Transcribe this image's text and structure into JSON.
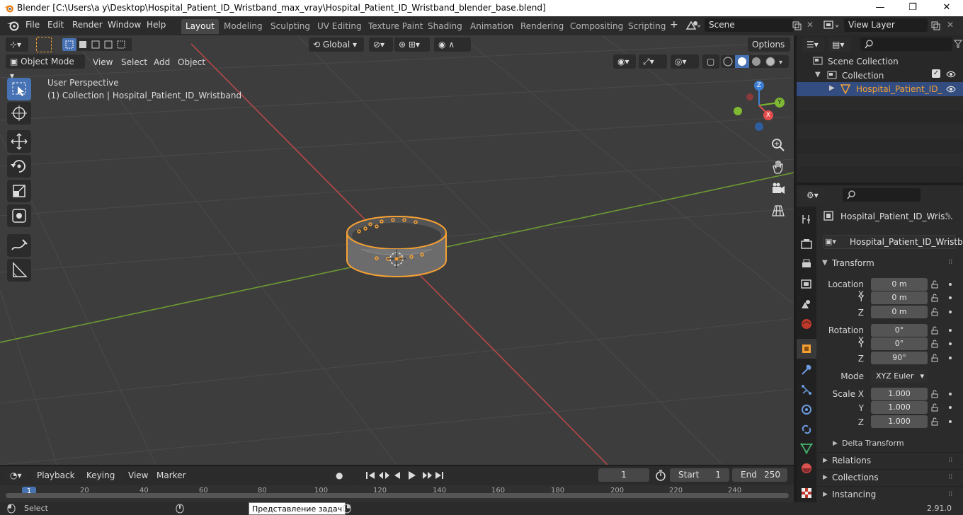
{
  "window": {
    "title": "Blender [C:\\Users\\a y\\Desktop\\Hospital_Patient_ID_Wristband_max_vray\\Hospital_Patient_ID_Wristband_blender_base.blend]",
    "minimize": "—",
    "maximize": "❐",
    "close": "✕"
  },
  "menu": {
    "items": [
      "File",
      "Edit",
      "Render",
      "Window",
      "Help"
    ],
    "workspaces": [
      "Layout",
      "Modeling",
      "Sculpting",
      "UV Editing",
      "Texture Paint",
      "Shading",
      "Animation",
      "Rendering",
      "Compositing",
      "Scripting"
    ],
    "add_workspace": "+",
    "scene": "Scene",
    "view_layer": "View Layer"
  },
  "viewport_header": {
    "transform_orientation": "Global",
    "options": "Options",
    "mode": "Object Mode",
    "menus": [
      "View",
      "Select",
      "Add",
      "Object"
    ]
  },
  "viewport": {
    "perspective": "User Perspective",
    "info": "(1) Collection | Hospital_Patient_ID_Wristband",
    "gizmo": {
      "x": "X",
      "y": "Y",
      "z": "Z"
    }
  },
  "outliner": {
    "scene_collection": "Scene Collection",
    "collection": "Collection",
    "object": "Hospital_Patient_ID_"
  },
  "properties": {
    "object_name": "Hospital_Patient_ID_Wris...",
    "data_name": "Hospital_Patient_ID_Wristba...",
    "transform_title": "Transform",
    "location_label": "Location X",
    "rotation_label": "Rotation X",
    "scale_label": "Scale X",
    "y": "Y",
    "z": "Z",
    "location": [
      "0 m",
      "0 m",
      "0 m"
    ],
    "rotation": [
      "0°",
      "0°",
      "90°"
    ],
    "mode_label": "Mode",
    "mode_value": "XYZ Euler",
    "scale": [
      "1.000",
      "1.000",
      "1.000"
    ],
    "delta": "Delta Transform",
    "sections": [
      "Relations",
      "Collections",
      "Instancing"
    ]
  },
  "timeline": {
    "menus": [
      "Playback",
      "Keying",
      "View",
      "Marker"
    ],
    "current_frame": "1",
    "start_label": "Start",
    "start": "1",
    "end_label": "End",
    "end": "250",
    "ruler": [
      "1",
      "20",
      "40",
      "60",
      "80",
      "100",
      "120",
      "140",
      "160",
      "180",
      "200",
      "220",
      "240"
    ]
  },
  "status": {
    "select": "Select",
    "tooltip": "Представление задач",
    "version": "2.91.0"
  },
  "colors": {
    "accent": "#4772b3",
    "selection_orange": "#f5a033",
    "x_axis": "#e34d4d",
    "y_axis": "#7fb833",
    "z_axis": "#3d7fd6"
  }
}
